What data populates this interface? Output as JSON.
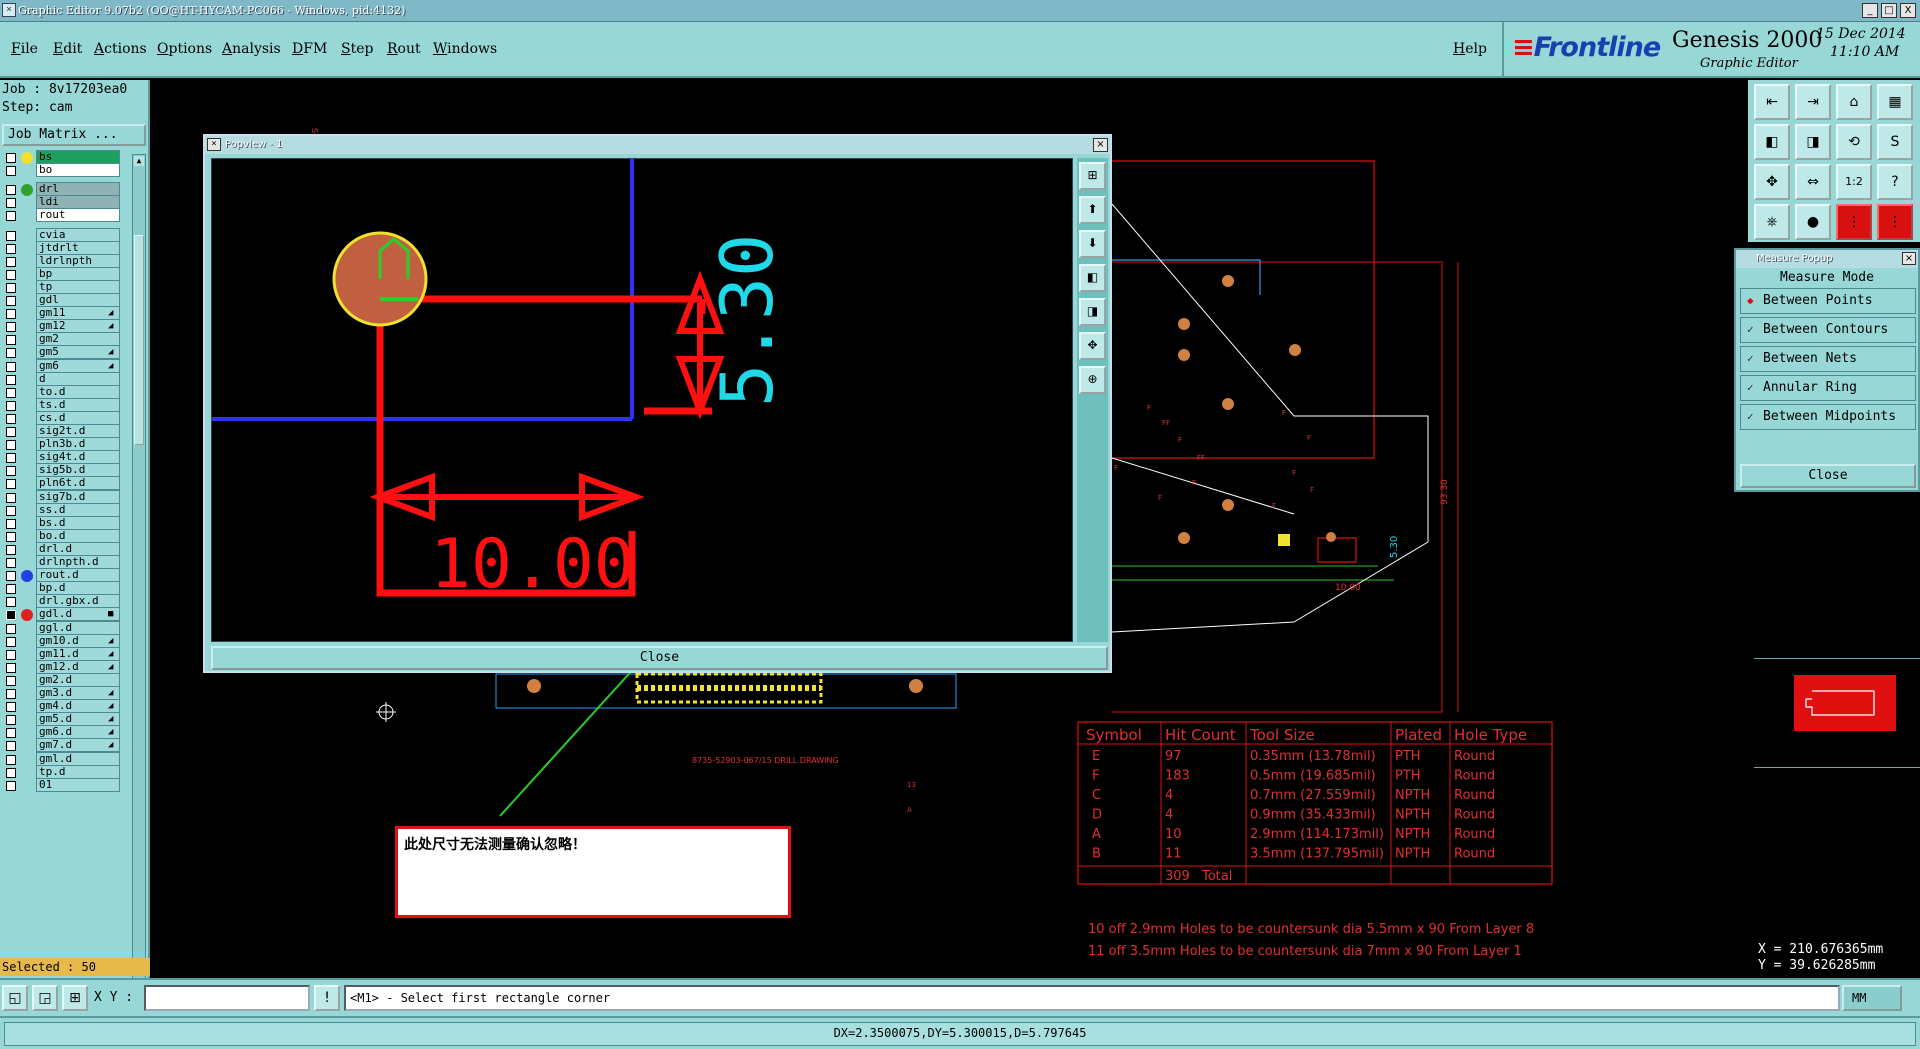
{
  "window": {
    "title": "Graphic Editor 9.07b2 (OO@HT-HYCAM-PC066 - Windows, pid:4132)",
    "controls": [
      "_",
      "□",
      "X"
    ]
  },
  "menubar": {
    "items": [
      "File",
      "Edit",
      "Actions",
      "Options",
      "Analysis",
      "DFM",
      "Step",
      "Rout",
      "Windows"
    ],
    "help": "Help"
  },
  "brand": {
    "logo": "Frontline",
    "product": "Genesis 2000",
    "subtitle": "Graphic Editor",
    "date": "15 Dec 2014",
    "time": "11:10 AM"
  },
  "job": {
    "job_label": "Job : 8v17203ea0",
    "step_label": "Step: cam",
    "matrix_button": "Job Matrix ..."
  },
  "layers": [
    {
      "name": "bs",
      "dot": "#f0e030",
      "style": "green"
    },
    {
      "name": "bo",
      "style": "white"
    },
    {
      "name": "drl",
      "dot": "#30a030",
      "style": "gray",
      "gap": true
    },
    {
      "name": "ldi",
      "style": "gray"
    },
    {
      "name": "rout",
      "style": "white"
    },
    {
      "name": "cvia",
      "gap": true
    },
    {
      "name": "jtdrlt"
    },
    {
      "name": "ldrlnpth"
    },
    {
      "name": "bp"
    },
    {
      "name": "tp"
    },
    {
      "name": "gdl"
    },
    {
      "name": "gm11",
      "mark": "◢"
    },
    {
      "name": "gm12",
      "mark": "◢"
    },
    {
      "name": "gm2"
    },
    {
      "name": "gm5",
      "mark": "◢"
    },
    {
      "name": "gm6",
      "mark": "◢"
    },
    {
      "name": "d"
    },
    {
      "name": "to.d"
    },
    {
      "name": "ts.d"
    },
    {
      "name": "cs.d"
    },
    {
      "name": "sig2t.d"
    },
    {
      "name": "pln3b.d"
    },
    {
      "name": "sig4t.d"
    },
    {
      "name": "sig5b.d"
    },
    {
      "name": "pln6t.d"
    },
    {
      "name": "sig7b.d"
    },
    {
      "name": "ss.d"
    },
    {
      "name": "bs.d"
    },
    {
      "name": "bo.d"
    },
    {
      "name": "drl.d"
    },
    {
      "name": "drlnpth.d"
    },
    {
      "name": "rout.d",
      "dot": "#2040e0"
    },
    {
      "name": "bp.d"
    },
    {
      "name": "drl.gbx.d"
    },
    {
      "name": "gdl.d",
      "dot": "#e02020",
      "mark": "■",
      "checked": true
    },
    {
      "name": "ggl.d"
    },
    {
      "name": "gm10.d",
      "mark": "◢"
    },
    {
      "name": "gm11.d",
      "mark": "◢"
    },
    {
      "name": "gm12.d",
      "mark": "◢"
    },
    {
      "name": "gm2.d"
    },
    {
      "name": "gm3.d",
      "mark": "◢"
    },
    {
      "name": "gm4.d",
      "mark": "◢"
    },
    {
      "name": "gm5.d",
      "mark": "◢"
    },
    {
      "name": "gm6.d",
      "mark": "◢"
    },
    {
      "name": "gm7.d",
      "mark": "◢"
    },
    {
      "name": "gml.d"
    },
    {
      "name": "tp.d"
    },
    {
      "name": "01"
    }
  ],
  "selected": "Selected : 50",
  "tools": [
    {
      "icon": "⇤",
      "name": "tool-open-icon"
    },
    {
      "icon": "⇥",
      "name": "tool-save-icon"
    },
    {
      "icon": "⌂",
      "name": "tool-home-icon"
    },
    {
      "icon": "▦",
      "name": "tool-grid-icon"
    },
    {
      "icon": "◧",
      "name": "tool-left-icon"
    },
    {
      "icon": "◨",
      "name": "tool-right-icon"
    },
    {
      "icon": "⟲",
      "name": "tool-undo-icon"
    },
    {
      "icon": "S",
      "name": "tool-snap-icon"
    },
    {
      "icon": "✥",
      "name": "tool-zoom-icon"
    },
    {
      "icon": "⇔",
      "name": "tool-pan-icon"
    },
    {
      "icon": "1:2",
      "name": "tool-scale-icon"
    },
    {
      "icon": "?",
      "name": "tool-help-icon"
    },
    {
      "icon": "⎈",
      "name": "tool-settings-icon"
    },
    {
      "icon": "●",
      "name": "tool-measure-icon"
    },
    {
      "icon": "⋮",
      "name": "tool-net-icon"
    },
    {
      "icon": "⋮",
      "name": "tool-net2-icon"
    }
  ],
  "measure_popup": {
    "title": "Measure Popup",
    "mode_label": "Measure Mode",
    "options": [
      {
        "label": "Between Points",
        "selected": true
      },
      {
        "label": "Between Contours",
        "selected": false
      },
      {
        "label": "Between Nets",
        "selected": false
      },
      {
        "label": "Annular Ring",
        "selected": false
      },
      {
        "label": "Between Midpoints",
        "selected": false
      }
    ],
    "close": "Close"
  },
  "popview": {
    "title": "Popview - 1",
    "close": "Close",
    "dim_horizontal": "10.00",
    "dim_vertical": "5.30"
  },
  "drill_table": {
    "headers": [
      "Symbol",
      "Hit Count",
      "Tool Size",
      "Plated",
      "Hole Type"
    ],
    "rows": [
      [
        "E",
        "97",
        "0.35mm (13.78mil)",
        "PTH",
        "Round"
      ],
      [
        "F",
        "183",
        "0.5mm (19.685mil)",
        "PTH",
        "Round"
      ],
      [
        "C",
        "4",
        "0.7mm (27.559mil)",
        "NPTH",
        "Round"
      ],
      [
        "D",
        "4",
        "0.9mm (35.433mil)",
        "NPTH",
        "Round"
      ],
      [
        "A",
        "10",
        "2.9mm (114.173mil)",
        "NPTH",
        "Round"
      ],
      [
        "B",
        "11",
        "3.5mm (137.795mil)",
        "NPTH",
        "Round"
      ]
    ],
    "total_count": "309",
    "total_label": "Total"
  },
  "notes": [
    "10 off 2.9mm Holes to be countersunk dia 5.5mm x 90  From Layer 8",
    "11 off 3.5mm Holes to be countersunk dia 7mm x 90  From Layer 1"
  ],
  "drawing_label": "8735-52903-067/15 DRILL DRAWING",
  "main_dims": {
    "dim_530": "5.30",
    "dim_1000": "10.00",
    "side_dim": "93.30"
  },
  "annotation": "此处尺寸无法测量确认忽略！",
  "coords": {
    "x": "X = 210.676365mm",
    "y": "Y = 39.626285mm"
  },
  "xy_label": "X Y :",
  "xy_value": "",
  "prompt": "<M1> - Select first rectangle corner",
  "unit": "MM",
  "status": "DX=2.3500075,DY=5.300015,D=5.797645",
  "colors": {
    "panel": "#97d7d6",
    "highlight_red": "#e01010",
    "measure_green": "#2ad02a",
    "dimension_cyan": "#1fd8e8"
  }
}
